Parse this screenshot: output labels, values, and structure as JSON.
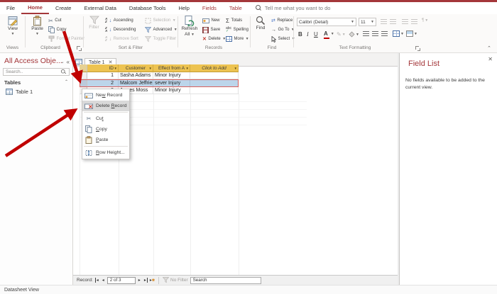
{
  "ribbon": {
    "tabs": [
      {
        "label": "File"
      },
      {
        "label": "Home"
      },
      {
        "label": "Create"
      },
      {
        "label": "External Data"
      },
      {
        "label": "Database Tools"
      },
      {
        "label": "Help"
      },
      {
        "label": "Fields"
      },
      {
        "label": "Table"
      }
    ],
    "tell_me": "Tell me what you want to do",
    "views": {
      "label": "Views",
      "view": "View"
    },
    "clipboard": {
      "label": "Clipboard",
      "paste": "Paste",
      "cut": "Cut",
      "copy": "Copy",
      "format_painter": "Format Painter"
    },
    "sort_filter": {
      "label": "Sort & Filter",
      "filter": "Filter",
      "ascending": "Ascending",
      "descending": "Descending",
      "remove_sort": "Remove Sort",
      "selection": "Selection",
      "advanced": "Advanced",
      "toggle_filter": "Toggle Filter"
    },
    "records": {
      "label": "Records",
      "refresh_line1": "Refresh",
      "refresh_line2": "All",
      "new": "New",
      "save": "Save",
      "delete": "Delete",
      "totals": "Totals",
      "spelling": "Spelling",
      "more": "More"
    },
    "find": {
      "label": "Find",
      "find": "Find",
      "replace": "Replace",
      "go_to": "Go To",
      "select": "Select"
    },
    "text_formatting": {
      "label": "Text Formatting",
      "font_name": "Calibri (Detail)",
      "font_size": "11",
      "bold": "B",
      "italic": "I",
      "underline": "U",
      "color_letter": "A"
    }
  },
  "nav_pane": {
    "title": "All Access Obje...",
    "search_placeholder": "Search..",
    "group_label": "Tables",
    "items": [
      {
        "label": "Table 1"
      }
    ]
  },
  "doc": {
    "tab_label": "Table 1",
    "grid": {
      "headers": [
        "ID",
        "Customer",
        "Effect from A",
        "Click to Add"
      ],
      "rows": [
        {
          "id": "1",
          "customer": "Sasha Adams",
          "effect": "Minor Injury"
        },
        {
          "id": "2",
          "customer": "Malcom Jeffries",
          "effect": "sever Injury"
        },
        {
          "id": "3",
          "customer": "James Moss",
          "effect": "Minor Injury"
        }
      ],
      "selected_row_index": 1
    },
    "context_menu": {
      "items": [
        {
          "pre": "Ne",
          "accel": "w",
          "post": " Record"
        },
        {
          "pre": "Delete ",
          "accel": "R",
          "post": "ecord"
        },
        {
          "pre": "Cu",
          "accel": "t",
          "post": ""
        },
        {
          "pre": "",
          "accel": "C",
          "post": "opy"
        },
        {
          "pre": "",
          "accel": "P",
          "post": "aste"
        },
        {
          "pre": "",
          "accel": "R",
          "post": "ow Height..."
        }
      ]
    },
    "record_nav": {
      "label": "Record:",
      "position": "2 of 3",
      "no_filter": "No Filter",
      "search_placeholder": "Search"
    }
  },
  "field_list": {
    "title": "Field List",
    "message": "No fields available to be added to the current view."
  },
  "status_bar": {
    "view_label": "Datasheet View"
  },
  "colors": {
    "accent": "#a4373a",
    "annotation_arrow": "#c00000",
    "grid_header_fill": "#edc351",
    "selected_row_fill": "#bcd5ea",
    "selected_row_border": "#d9605c"
  }
}
